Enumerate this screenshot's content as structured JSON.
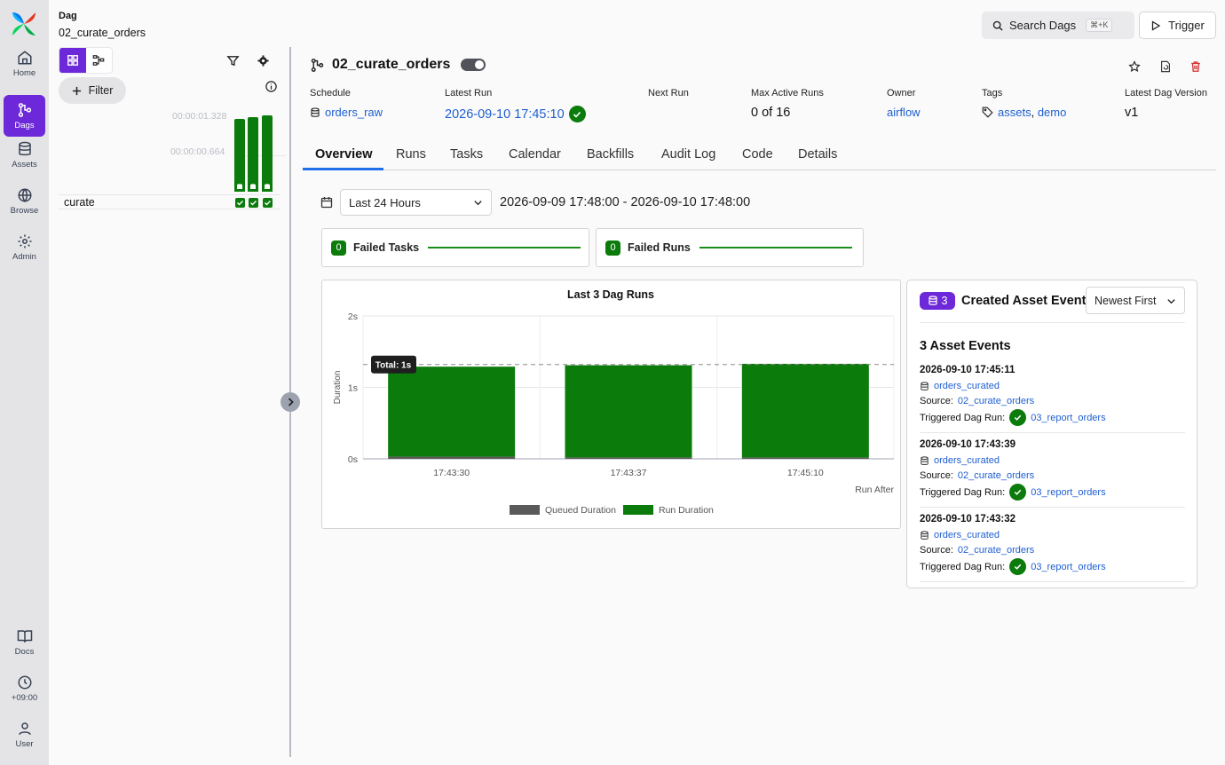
{
  "nav": {
    "items": [
      {
        "label": "Home"
      },
      {
        "label": "Dags"
      },
      {
        "label": "Assets"
      },
      {
        "label": "Browse"
      },
      {
        "label": "Admin"
      },
      {
        "label": "Docs"
      },
      {
        "label": "+09:00"
      },
      {
        "label": "User"
      }
    ]
  },
  "left": {
    "kicker": "Dag",
    "dag_name": "02_curate_orders",
    "filter_label": "Filter",
    "durations": [
      "00:00:01.328",
      "00:00:00.664"
    ],
    "task_name": "curate",
    "run_bars": [
      0.93,
      0.95,
      0.98
    ]
  },
  "header": {
    "search_label": "Search Dags",
    "search_shortcut": "⌘+K",
    "trigger_label": "Trigger"
  },
  "dag": {
    "title": "02_curate_orders",
    "meta": {
      "schedule_label": "Schedule",
      "schedule_value": "orders_raw",
      "latest_run_label": "Latest Run",
      "latest_run_value": "2026-09-10 17:45:10",
      "next_run_label": "Next Run",
      "next_run_value": "",
      "max_active_label": "Max Active Runs",
      "max_active_value": "0 of 16",
      "owner_label": "Owner",
      "owner_value": "airflow",
      "tags_label": "Tags",
      "tag1": "assets",
      "tag_sep": ",",
      "tag2": "demo",
      "version_label": "Latest Dag Version",
      "version_value": "v1"
    }
  },
  "tabs": [
    "Overview",
    "Runs",
    "Tasks",
    "Calendar",
    "Backfills",
    "Audit Log",
    "Code",
    "Details"
  ],
  "overview": {
    "range_select": "Last 24 Hours",
    "range_text": "2026-09-09 17:48:00 - 2026-09-10 17:48:00",
    "failed_tasks_count": "0",
    "failed_tasks_label": "Failed Tasks",
    "failed_runs_count": "0",
    "failed_runs_label": "Failed Runs"
  },
  "chart_data": {
    "type": "bar",
    "title": "Last 3 Dag Runs",
    "xlabel": "Run After",
    "ylabel": "Duration",
    "categories": [
      "17:43:30",
      "17:43:37",
      "17:45:10"
    ],
    "series": [
      {
        "name": "Queued Duration",
        "values": [
          0.03,
          0.02,
          0.02
        ],
        "color": "#5a5a5a"
      },
      {
        "name": "Run Duration",
        "values": [
          1.26,
          1.29,
          1.31
        ],
        "color": "#0b7b0b"
      }
    ],
    "yticks": [
      "0s",
      "1s",
      "2s"
    ],
    "ylim": [
      0,
      2
    ],
    "reference_value": 1.32,
    "tooltip": "Total: 1s",
    "stacked": true,
    "legend": "bottom",
    "grid": true
  },
  "assets": {
    "count": "3",
    "title": "Created Asset Events",
    "sort_select": "Newest First",
    "events_heading": "3 Asset Events",
    "source_label": "Source:",
    "triggered_label": "Triggered Dag Run:",
    "events": [
      {
        "timestamp": "2026-09-10 17:45:11",
        "asset": "orders_curated",
        "source": "02_curate_orders",
        "triggered": "03_report_orders"
      },
      {
        "timestamp": "2026-09-10 17:43:39",
        "asset": "orders_curated",
        "source": "02_curate_orders",
        "triggered": "03_report_orders"
      },
      {
        "timestamp": "2026-09-10 17:43:32",
        "asset": "orders_curated",
        "source": "02_curate_orders",
        "triggered": "03_report_orders"
      }
    ]
  }
}
